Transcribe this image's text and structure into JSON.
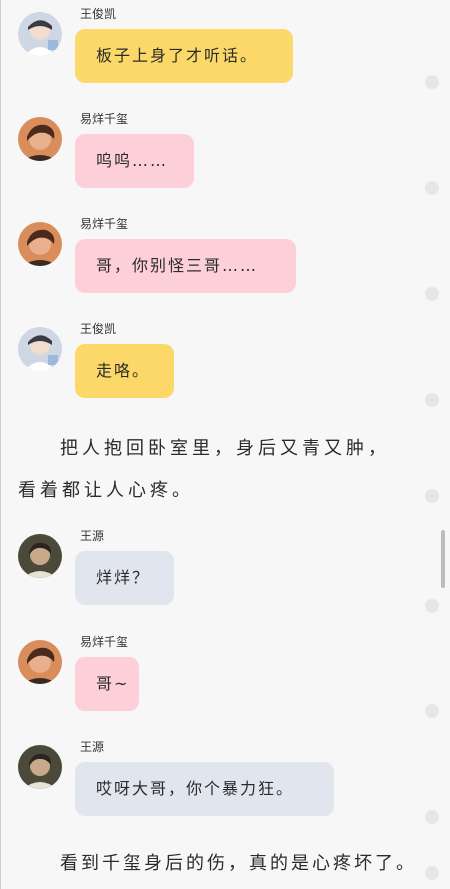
{
  "colors": {
    "bubble_wang_junkai": "#fbd867",
    "bubble_yi_yangqianxi": "#fccfd9",
    "bubble_wang_yuan": "#e1e5ee",
    "background": "#f7f7f7"
  },
  "messages": [
    {
      "sender": "王俊凯",
      "text": "板子上身了才听话。",
      "avatar": "avatar-wang-junkai"
    },
    {
      "sender": "易烊千玺",
      "text": "呜呜……",
      "avatar": "avatar-yi-yangqianxi"
    },
    {
      "sender": "易烊千玺",
      "text": "哥，你别怪三哥……",
      "avatar": "avatar-yi-yangqianxi"
    },
    {
      "sender": "王俊凯",
      "text": "走咯。",
      "avatar": "avatar-wang-junkai"
    },
    {
      "sender": "王源",
      "text": "烊烊？",
      "avatar": "avatar-wang-yuan"
    },
    {
      "sender": "易烊千玺",
      "text": "哥~",
      "avatar": "avatar-yi-yangqianxi"
    },
    {
      "sender": "王源",
      "text": "哎呀大哥，你个暴力狂。",
      "avatar": "avatar-wang-yuan"
    }
  ],
  "narration": [
    "把人抱回卧室里，身后又青又肿，看着都让人心疼。",
    "看到千玺身后的伤，真的是心疼坏了。"
  ]
}
